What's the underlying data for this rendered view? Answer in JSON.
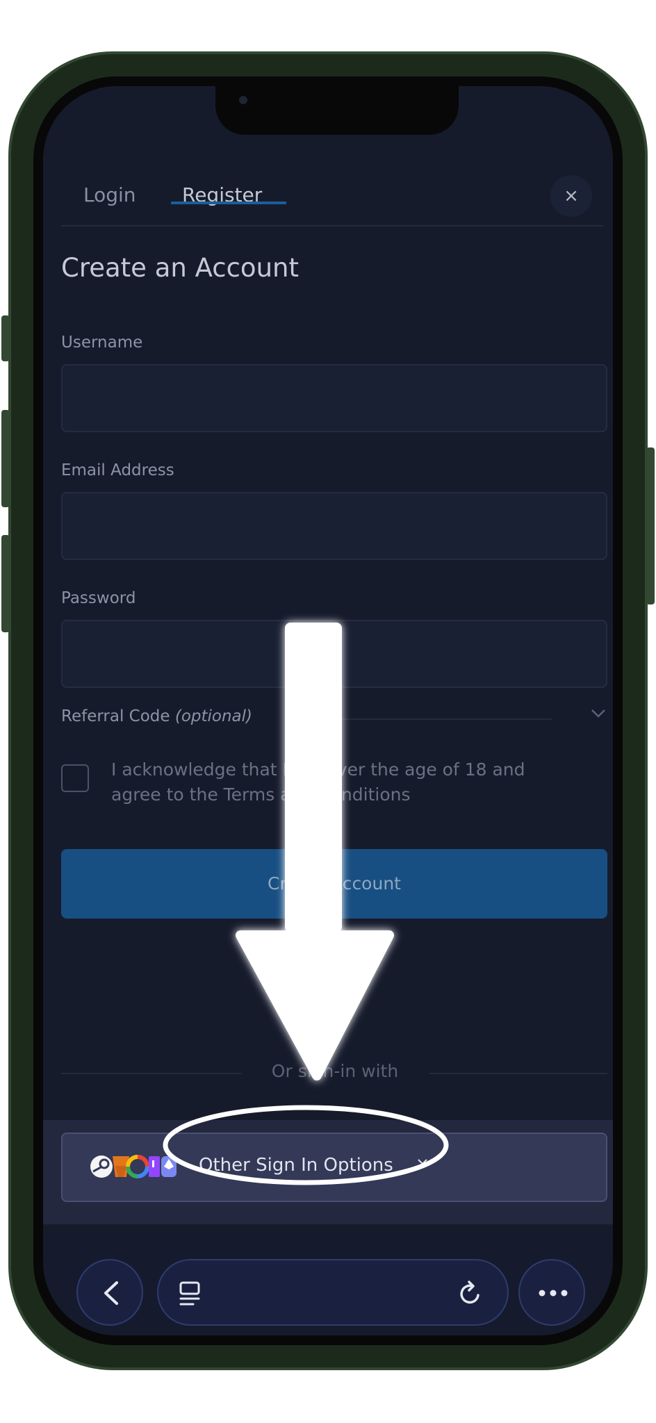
{
  "tabs": [
    {
      "label": "Login",
      "active": false
    },
    {
      "label": "Register",
      "active": true
    }
  ],
  "close_icon": "×",
  "form": {
    "title": "Create an Account",
    "username_label": "Username",
    "username_value": "",
    "email_label": "Email Address",
    "email_value": "",
    "password_label": "Password",
    "password_value": "",
    "referral_label": "Referral Code",
    "referral_optional": "(optional)",
    "terms_text": "I acknowledge that I am over the age of 18 and agree to the Terms and Conditions",
    "terms_checked": false,
    "submit_label": "Create Account"
  },
  "divider_text": "Or sign-in with",
  "other_sign_in": {
    "label": "Other Sign In Options",
    "provider_icons": [
      "steam-icon",
      "metamask-icon",
      "google-icon",
      "twitch-icon",
      "ethereum-icon"
    ]
  },
  "browser_toolbar": {
    "icons": [
      "back-icon",
      "tabs-icon",
      "reload-icon",
      "more-icon"
    ]
  },
  "colors": {
    "background": "#161b2c",
    "accent": "#1c5e9a",
    "button": "#184f82",
    "annotation": "#ffffff"
  }
}
